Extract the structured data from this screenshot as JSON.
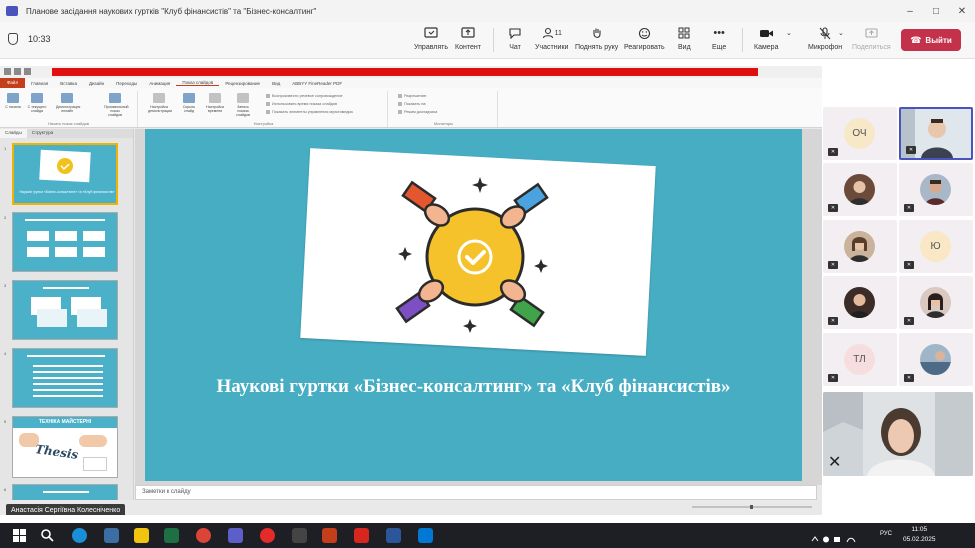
{
  "window": {
    "title": "Планове засідання наукових гуртків \"Клуб фінансистів\" та \"Бізнес-консалтинг\"",
    "controls": [
      "–",
      "□",
      "✕"
    ]
  },
  "meeting": {
    "timer": "10:33",
    "toolbar": {
      "manage": "Управлять",
      "content": "Контент",
      "chat": "Чат",
      "participants": "Участники",
      "participants_count": "11",
      "raise_hand": "Поднять руку",
      "react": "Реагировать",
      "view": "Вид",
      "more": "Еще",
      "camera": "Камера",
      "mic": "Микрофон",
      "share": "Поделиться",
      "leave": "Выйти"
    }
  },
  "powerpoint": {
    "tabs": [
      "Файл",
      "Главная",
      "Вставка",
      "Дизайн",
      "Переходы",
      "Анимация",
      "Показ слайдов",
      "Рецензирование",
      "Вид",
      "ABBYY FineReader PDF"
    ],
    "active_tab": "Показ слайдов",
    "ribbon": {
      "groups": [
        "Начать показ слайдов",
        "Настройка",
        "Мониторы"
      ],
      "items": [
        "С начала",
        "С текущего слайда",
        "Демонстрация онлайн",
        "Произвольный показ слайдов",
        "Настройка демонстрации",
        "Скрыть слайд",
        "Настройка времени",
        "Запись показа слайдов"
      ],
      "checkboxes": [
        "Воспроизвести речевое сопровождение",
        "Использовать время показа слайдов",
        "Показать элементы управления мультимедиа"
      ],
      "monitor_lines": [
        "Разрешение:",
        "Показать на:",
        "Режим докладчика"
      ]
    },
    "pane_tabs": [
      "Слайды",
      "Структура"
    ],
    "thumbnails": [
      {
        "num": "1",
        "caption": "Наукові гуртки «Бізнес-консалтинг» та «Клуб фінансистів»"
      },
      {
        "num": "2",
        "caption": ""
      },
      {
        "num": "3",
        "caption": ""
      },
      {
        "num": "4",
        "caption": ""
      },
      {
        "num": "5",
        "caption": "ТЕХНІКА МАЙСТЕРНІ",
        "extra": "Thesis"
      },
      {
        "num": "6",
        "caption": ""
      }
    ],
    "slide_title": "Наукові гуртки «Бізнес-консалтинг» та «Клуб фінансистів»",
    "notes_placeholder": "Заметки к слайду"
  },
  "presenter_name": "Анастасія Сергіївна Колесніченко",
  "participants": [
    {
      "initials": "ОЧ",
      "bg": "#f7e8c8",
      "kind": "initials"
    },
    {
      "initials": "",
      "kind": "photo",
      "active": true
    },
    {
      "initials": "",
      "kind": "photo"
    },
    {
      "initials": "",
      "kind": "photo"
    },
    {
      "initials": "",
      "kind": "photo"
    },
    {
      "initials": "Ю",
      "bg": "#f9e7c6",
      "kind": "initials"
    },
    {
      "initials": "",
      "kind": "photo"
    },
    {
      "initials": "",
      "kind": "photo"
    },
    {
      "initials": "ТЛ",
      "bg": "#f7dede",
      "kind": "initials"
    },
    {
      "initials": "",
      "kind": "photo"
    }
  ],
  "taskbar": {
    "language": "РУС",
    "time": "11:05",
    "date": "05.02.2025"
  },
  "colors": {
    "slide_bg": "#47adc3",
    "leave": "#c4314b",
    "teams_accent": "#4b53bc",
    "ppt_file_tab": "#c43e1c"
  }
}
